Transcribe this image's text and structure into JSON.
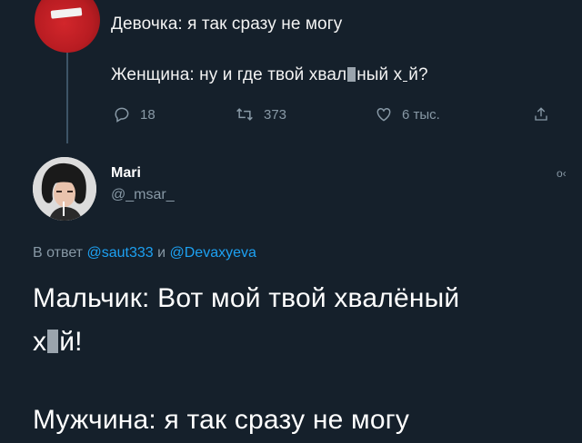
{
  "parent_tweet": {
    "line1": "Девочка: я так сразу не могу",
    "line2_part1": "Женщина: ну и где твой хвал",
    "line2_part2": "ный х",
    "line2_part3": "й?",
    "actions": {
      "reply_count": "18",
      "retweet_count": "373",
      "like_count": "6 тыс."
    }
  },
  "reply_tweet": {
    "author_name": "Mari",
    "author_handle": "@_msar_",
    "reply_prefix": "В ответ",
    "mention1": "@saut333",
    "conjunction": "и",
    "mention2": "@Devaxyeva",
    "text_line1": "Мальчик: Вот мой твой хвалёный",
    "text_line2_part1": "х",
    "text_line2_part2": "й!",
    "text_line3": "Мужчина: я так сразу не могу"
  },
  "colors": {
    "background": "#15202b",
    "secondary_text": "#8899a6",
    "link": "#1da1f2"
  },
  "icons": [
    "reply-icon",
    "retweet-icon",
    "like-icon",
    "share-icon",
    "more-icon"
  ]
}
